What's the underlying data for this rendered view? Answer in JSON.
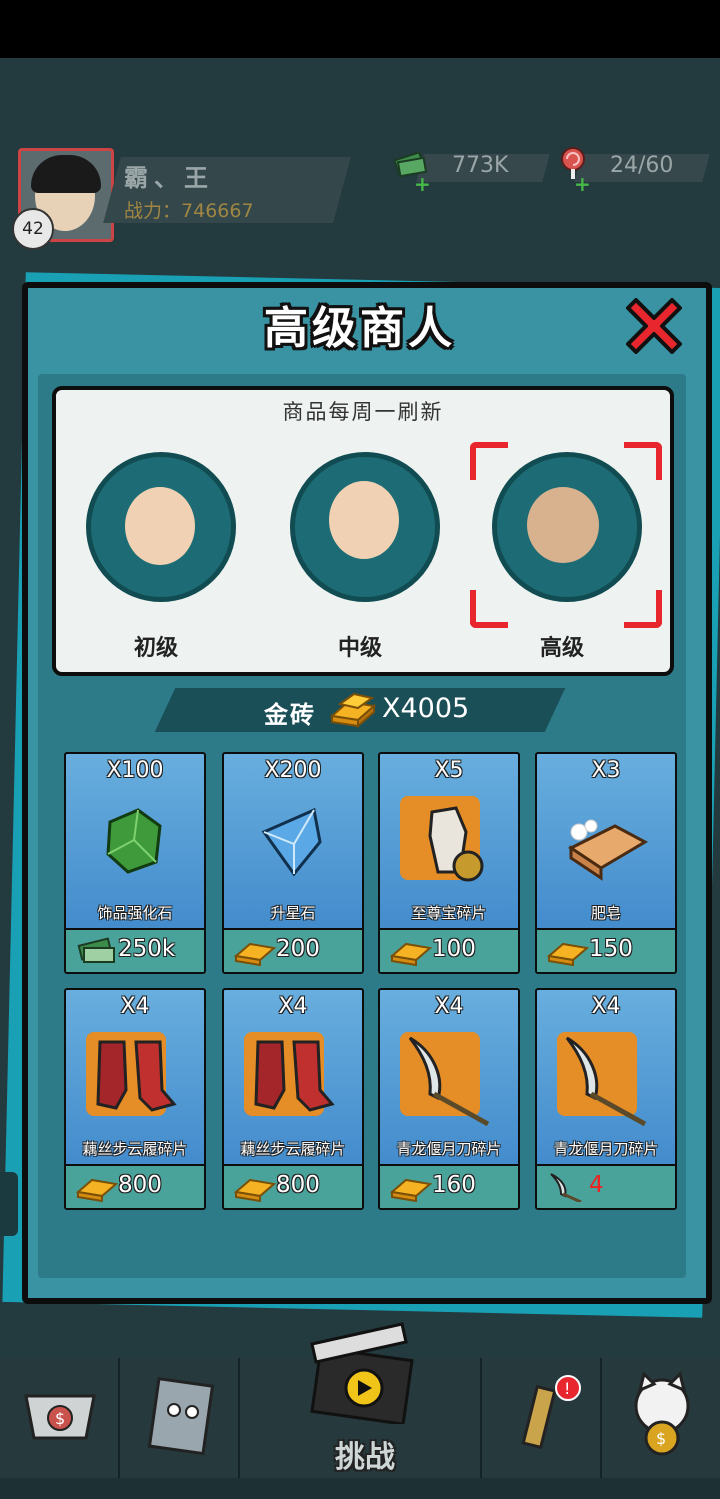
{
  "player": {
    "name": "霸、王",
    "level": "42",
    "power_label": "战力：",
    "power_value": "746667"
  },
  "resources": {
    "cash": "773K",
    "stamina": "24/60"
  },
  "shop": {
    "title": "高级商人",
    "refresh_note": "商品每周一刷新",
    "merchants": [
      {
        "label": "初级",
        "selected": false
      },
      {
        "label": "中级",
        "selected": false
      },
      {
        "label": "高级",
        "selected": true
      }
    ],
    "currency_label": "金砖",
    "currency_count": "X4005",
    "items": [
      {
        "qty": "X100",
        "name": "饰品强化石",
        "price": "250k",
        "price_icon": "cash-icon",
        "icon": "green-gem-icon"
      },
      {
        "qty": "X200",
        "name": "升星石",
        "price": "200",
        "price_icon": "gold-brick-icon",
        "icon": "blue-crystal-icon"
      },
      {
        "qty": "X5",
        "name": "至尊宝碎片",
        "price": "100",
        "price_icon": "gold-brick-icon",
        "icon": "outfit-fragment-icon"
      },
      {
        "qty": "X3",
        "name": "肥皂",
        "price": "150",
        "price_icon": "gold-brick-icon",
        "icon": "soap-icon"
      },
      {
        "qty": "X4",
        "name": "藕丝步云履碎片",
        "price": "800",
        "price_icon": "gold-brick-icon",
        "icon": "boots-fragment-icon"
      },
      {
        "qty": "X4",
        "name": "藕丝步云履碎片",
        "price": "800",
        "price_icon": "gold-brick-icon",
        "icon": "boots-fragment-icon"
      },
      {
        "qty": "X4",
        "name": "青龙偃月刀碎片",
        "price": "160",
        "price_icon": "gold-brick-icon",
        "icon": "glaive-fragment-icon"
      },
      {
        "qty": "X4",
        "name": "青龙偃月刀碎片",
        "price": "4",
        "price_icon": "glaive-icon",
        "icon": "glaive-fragment-icon"
      }
    ]
  },
  "nav": {
    "challenge_label": "挑战"
  },
  "colors": {
    "panel": "#3a93a3",
    "card_blue": "#4f95d4",
    "price_teal": "#4aa39a",
    "close_red": "#e8262d",
    "fragment_orange": "#e58d26"
  }
}
